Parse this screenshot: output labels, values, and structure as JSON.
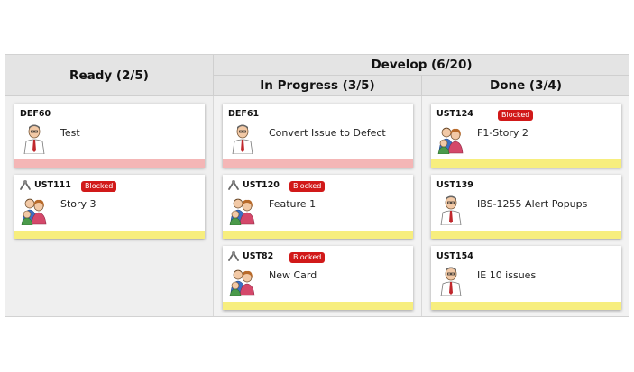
{
  "board": {
    "columns": {
      "ready": {
        "label": "Ready (2/5)"
      },
      "develop": {
        "label": "Develop (6/20)"
      },
      "in_progress": {
        "label": "In Progress (3/5)"
      },
      "done": {
        "label": "Done (3/4)"
      }
    },
    "blocked_label": "Blocked",
    "cards": {
      "def60": {
        "id": "DEF60",
        "title": "Test"
      },
      "ust111": {
        "id": "UST111",
        "title": "Story 3"
      },
      "def61": {
        "id": "DEF61",
        "title": "Convert Issue to Defect"
      },
      "ust120": {
        "id": "UST120",
        "title": "Feature 1"
      },
      "ust82": {
        "id": "UST82",
        "title": "New Card"
      },
      "ust124": {
        "id": "UST124",
        "title": "F1-Story 2"
      },
      "ust139": {
        "id": "UST139",
        "title": "IBS-1255 Alert Popups"
      },
      "ust154": {
        "id": "UST154",
        "title": "IE 10 issues"
      }
    }
  },
  "colors": {
    "defect_band": "#f4b6b6",
    "story_band": "#f7ee7e",
    "blocked_badge": "#d11919"
  }
}
